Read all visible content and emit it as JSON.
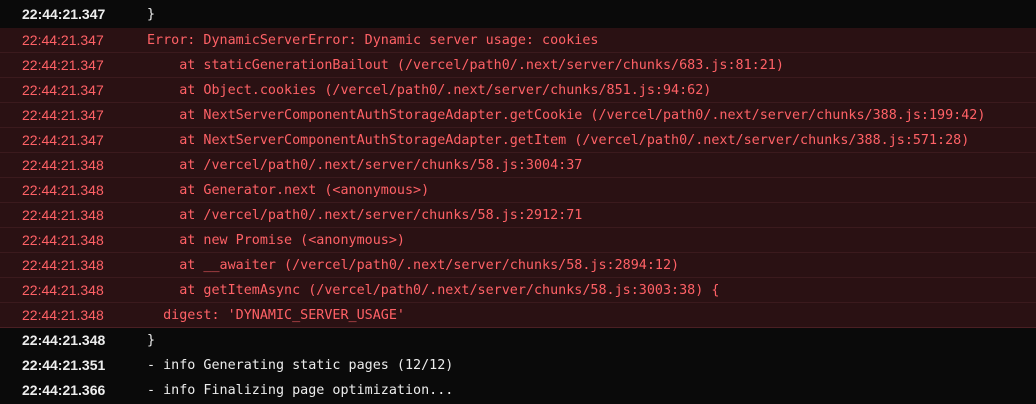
{
  "colors": {
    "background": "#0a0a0a",
    "error_background": "#2a1113",
    "error_text": "#ff6166",
    "normal_text": "#ededed"
  },
  "rows": [
    {
      "time": "22:44:21.347",
      "text": "}",
      "level": "info"
    },
    {
      "time": "22:44:21.347",
      "text": "Error: DynamicServerError: Dynamic server usage: cookies",
      "level": "error"
    },
    {
      "time": "22:44:21.347",
      "text": "    at staticGenerationBailout (/vercel/path0/.next/server/chunks/683.js:81:21)",
      "level": "error"
    },
    {
      "time": "22:44:21.347",
      "text": "    at Object.cookies (/vercel/path0/.next/server/chunks/851.js:94:62)",
      "level": "error"
    },
    {
      "time": "22:44:21.347",
      "text": "    at NextServerComponentAuthStorageAdapter.getCookie (/vercel/path0/.next/server/chunks/388.js:199:42)",
      "level": "error"
    },
    {
      "time": "22:44:21.347",
      "text": "    at NextServerComponentAuthStorageAdapter.getItem (/vercel/path0/.next/server/chunks/388.js:571:28)",
      "level": "error"
    },
    {
      "time": "22:44:21.348",
      "text": "    at /vercel/path0/.next/server/chunks/58.js:3004:37",
      "level": "error"
    },
    {
      "time": "22:44:21.348",
      "text": "    at Generator.next (<anonymous>)",
      "level": "error"
    },
    {
      "time": "22:44:21.348",
      "text": "    at /vercel/path0/.next/server/chunks/58.js:2912:71",
      "level": "error"
    },
    {
      "time": "22:44:21.348",
      "text": "    at new Promise (<anonymous>)",
      "level": "error"
    },
    {
      "time": "22:44:21.348",
      "text": "    at __awaiter (/vercel/path0/.next/server/chunks/58.js:2894:12)",
      "level": "error"
    },
    {
      "time": "22:44:21.348",
      "text": "    at getItemAsync (/vercel/path0/.next/server/chunks/58.js:3003:38) {",
      "level": "error"
    },
    {
      "time": "22:44:21.348",
      "text": "  digest: 'DYNAMIC_SERVER_USAGE'",
      "level": "error"
    },
    {
      "time": "22:44:21.348",
      "text": "}",
      "level": "info"
    },
    {
      "time": "22:44:21.351",
      "text": "- info Generating static pages (12/12)",
      "level": "info"
    },
    {
      "time": "22:44:21.366",
      "text": "- info Finalizing page optimization...",
      "level": "info"
    }
  ]
}
